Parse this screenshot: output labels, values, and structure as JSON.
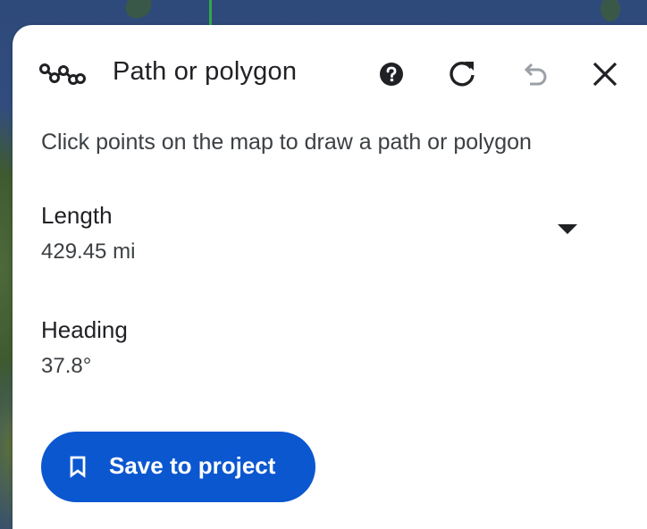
{
  "panel": {
    "title": "Path or polygon",
    "instruction": "Click points on the map to draw a path or polygon",
    "icons": {
      "path": "path-polyline-icon",
      "help": "help-icon",
      "refresh": "refresh-icon",
      "undo": "undo-icon",
      "close": "close-icon",
      "dropdown": "chevron-down-icon",
      "bookmark": "bookmark-icon"
    }
  },
  "metrics": {
    "length": {
      "label": "Length",
      "value": "429.45 mi"
    },
    "heading": {
      "label": "Heading",
      "value": "37.8°"
    }
  },
  "actions": {
    "save_label": "Save to project"
  },
  "colors": {
    "accent": "#0b57d0",
    "text_primary": "#202124",
    "text_secondary": "#3c4043",
    "icon_disabled": "#9aa0a6",
    "map_water": "#2f4a78"
  }
}
